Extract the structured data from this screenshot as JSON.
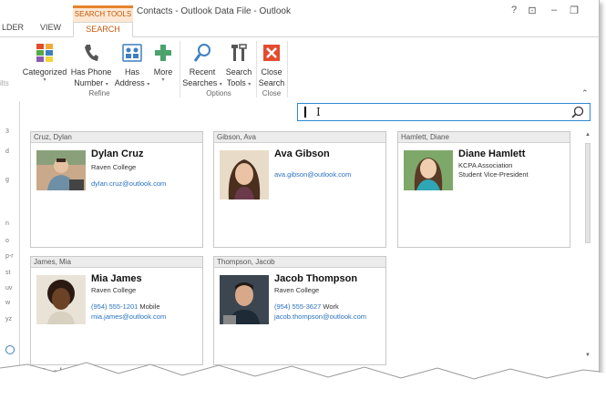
{
  "title": {
    "contextual_group": "SEARCH TOOLS",
    "window_title": "Contacts - Outlook Data File - Outlook",
    "help": "?",
    "restore_ribbon": "⊡",
    "minimize": "–",
    "maximize": "❐"
  },
  "tabs": {
    "folder": "LDER",
    "view": "VIEW",
    "search": "SEARCH"
  },
  "ribbon": {
    "left_cut": "ilts",
    "categorized": "Categorized",
    "has_phone": [
      "Has Phone",
      "Number"
    ],
    "has_address": [
      "Has",
      "Address"
    ],
    "more": "More",
    "refine_label": "Refine",
    "recent_searches": [
      "Recent",
      "Searches"
    ],
    "search_tools": [
      "Search",
      "Tools"
    ],
    "options_label": "Options",
    "close_search": [
      "Close",
      "Search"
    ],
    "close_label": "Close",
    "colors": {
      "accent": "#e6832b",
      "link": "#2a72c0",
      "search_border": "#2a8ad4"
    }
  },
  "left_letters": [
    "3",
    "d",
    "g",
    "n",
    "o",
    "p-r",
    "st",
    "uv",
    "w",
    "yz"
  ],
  "contacts": [
    {
      "header": "Cruz, Dylan",
      "name": "Dylan Cruz",
      "lines": [
        "Raven College"
      ],
      "email": "dylan.cruz@outlook.com"
    },
    {
      "header": "Gibson, Ava",
      "name": "Ava Gibson",
      "lines": [],
      "email": "ava.gibson@outlook.com"
    },
    {
      "header": "Hamlett, Diane",
      "name": "Diane Hamlett",
      "lines": [
        "KCPA Association",
        "Student Vice-President"
      ],
      "email": ""
    },
    {
      "header": "James, Mia",
      "name": "Mia James",
      "lines": [
        "Raven College"
      ],
      "phone": "(954) 555-1201",
      "phone_type": "Mobile",
      "email": "mia.james@outlook.com"
    },
    {
      "header": "Thompson, Jacob",
      "name": "Jacob Thompson",
      "lines": [
        "Raven College"
      ],
      "phone": "(954) 555-3627",
      "phone_type": "Work",
      "email": "jacob.thompson@outlook.com"
    }
  ],
  "bottom_nav": {
    "people_cut": "le",
    "tasks": "Task"
  }
}
